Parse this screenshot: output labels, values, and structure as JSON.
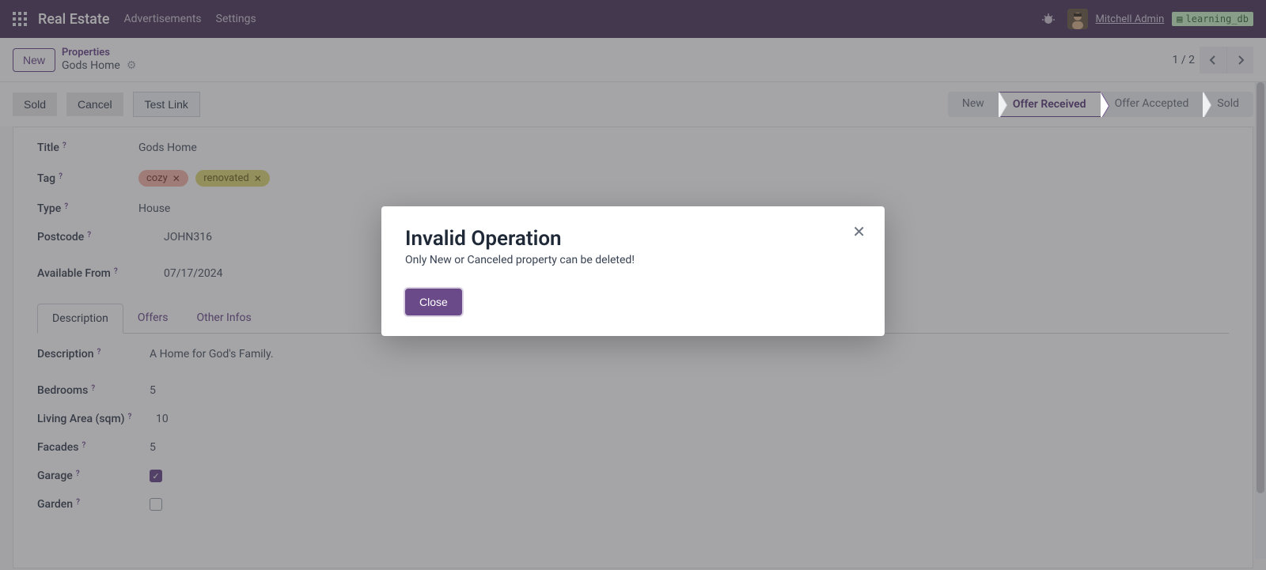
{
  "navbar": {
    "brand": "Real Estate",
    "links": [
      "Advertisements",
      "Settings"
    ],
    "username": "Mitchell Admin",
    "dbname": "learning_db"
  },
  "control": {
    "new_label": "New",
    "breadcrumb_root": "Properties",
    "breadcrumb_current": "Gods Home",
    "pager": "1 / 2"
  },
  "actions": {
    "sold": "Sold",
    "cancel": "Cancel",
    "test_link": "Test Link"
  },
  "status_steps": [
    "New",
    "Offer Received",
    "Offer Accepted",
    "Sold"
  ],
  "status_active_index": 1,
  "form": {
    "title_label": "Title",
    "title_value": "Gods Home",
    "tag_label": "Tag",
    "tags": [
      {
        "label": "cozy",
        "color": "red"
      },
      {
        "label": "renovated",
        "color": "yellow"
      }
    ],
    "type_label": "Type",
    "type_value": "House",
    "postcode_label": "Postcode",
    "postcode_value": "JOHN316",
    "available_from_label": "Available From",
    "available_from_value": "07/17/2024"
  },
  "tabs": [
    "Description",
    "Offers",
    "Other Infos"
  ],
  "tab_active_index": 0,
  "desc": {
    "description_label": "Description",
    "description_value": "A Home for God's Family.",
    "bedrooms_label": "Bedrooms",
    "bedrooms_value": "5",
    "living_area_label": "Living Area (sqm)",
    "living_area_value": "10",
    "facades_label": "Facades",
    "facades_value": "5",
    "garage_label": "Garage",
    "garage_checked": true,
    "garden_label": "Garden",
    "garden_checked": false
  },
  "modal": {
    "title": "Invalid Operation",
    "message": "Only New or Canceled property can be deleted!",
    "close": "Close"
  }
}
